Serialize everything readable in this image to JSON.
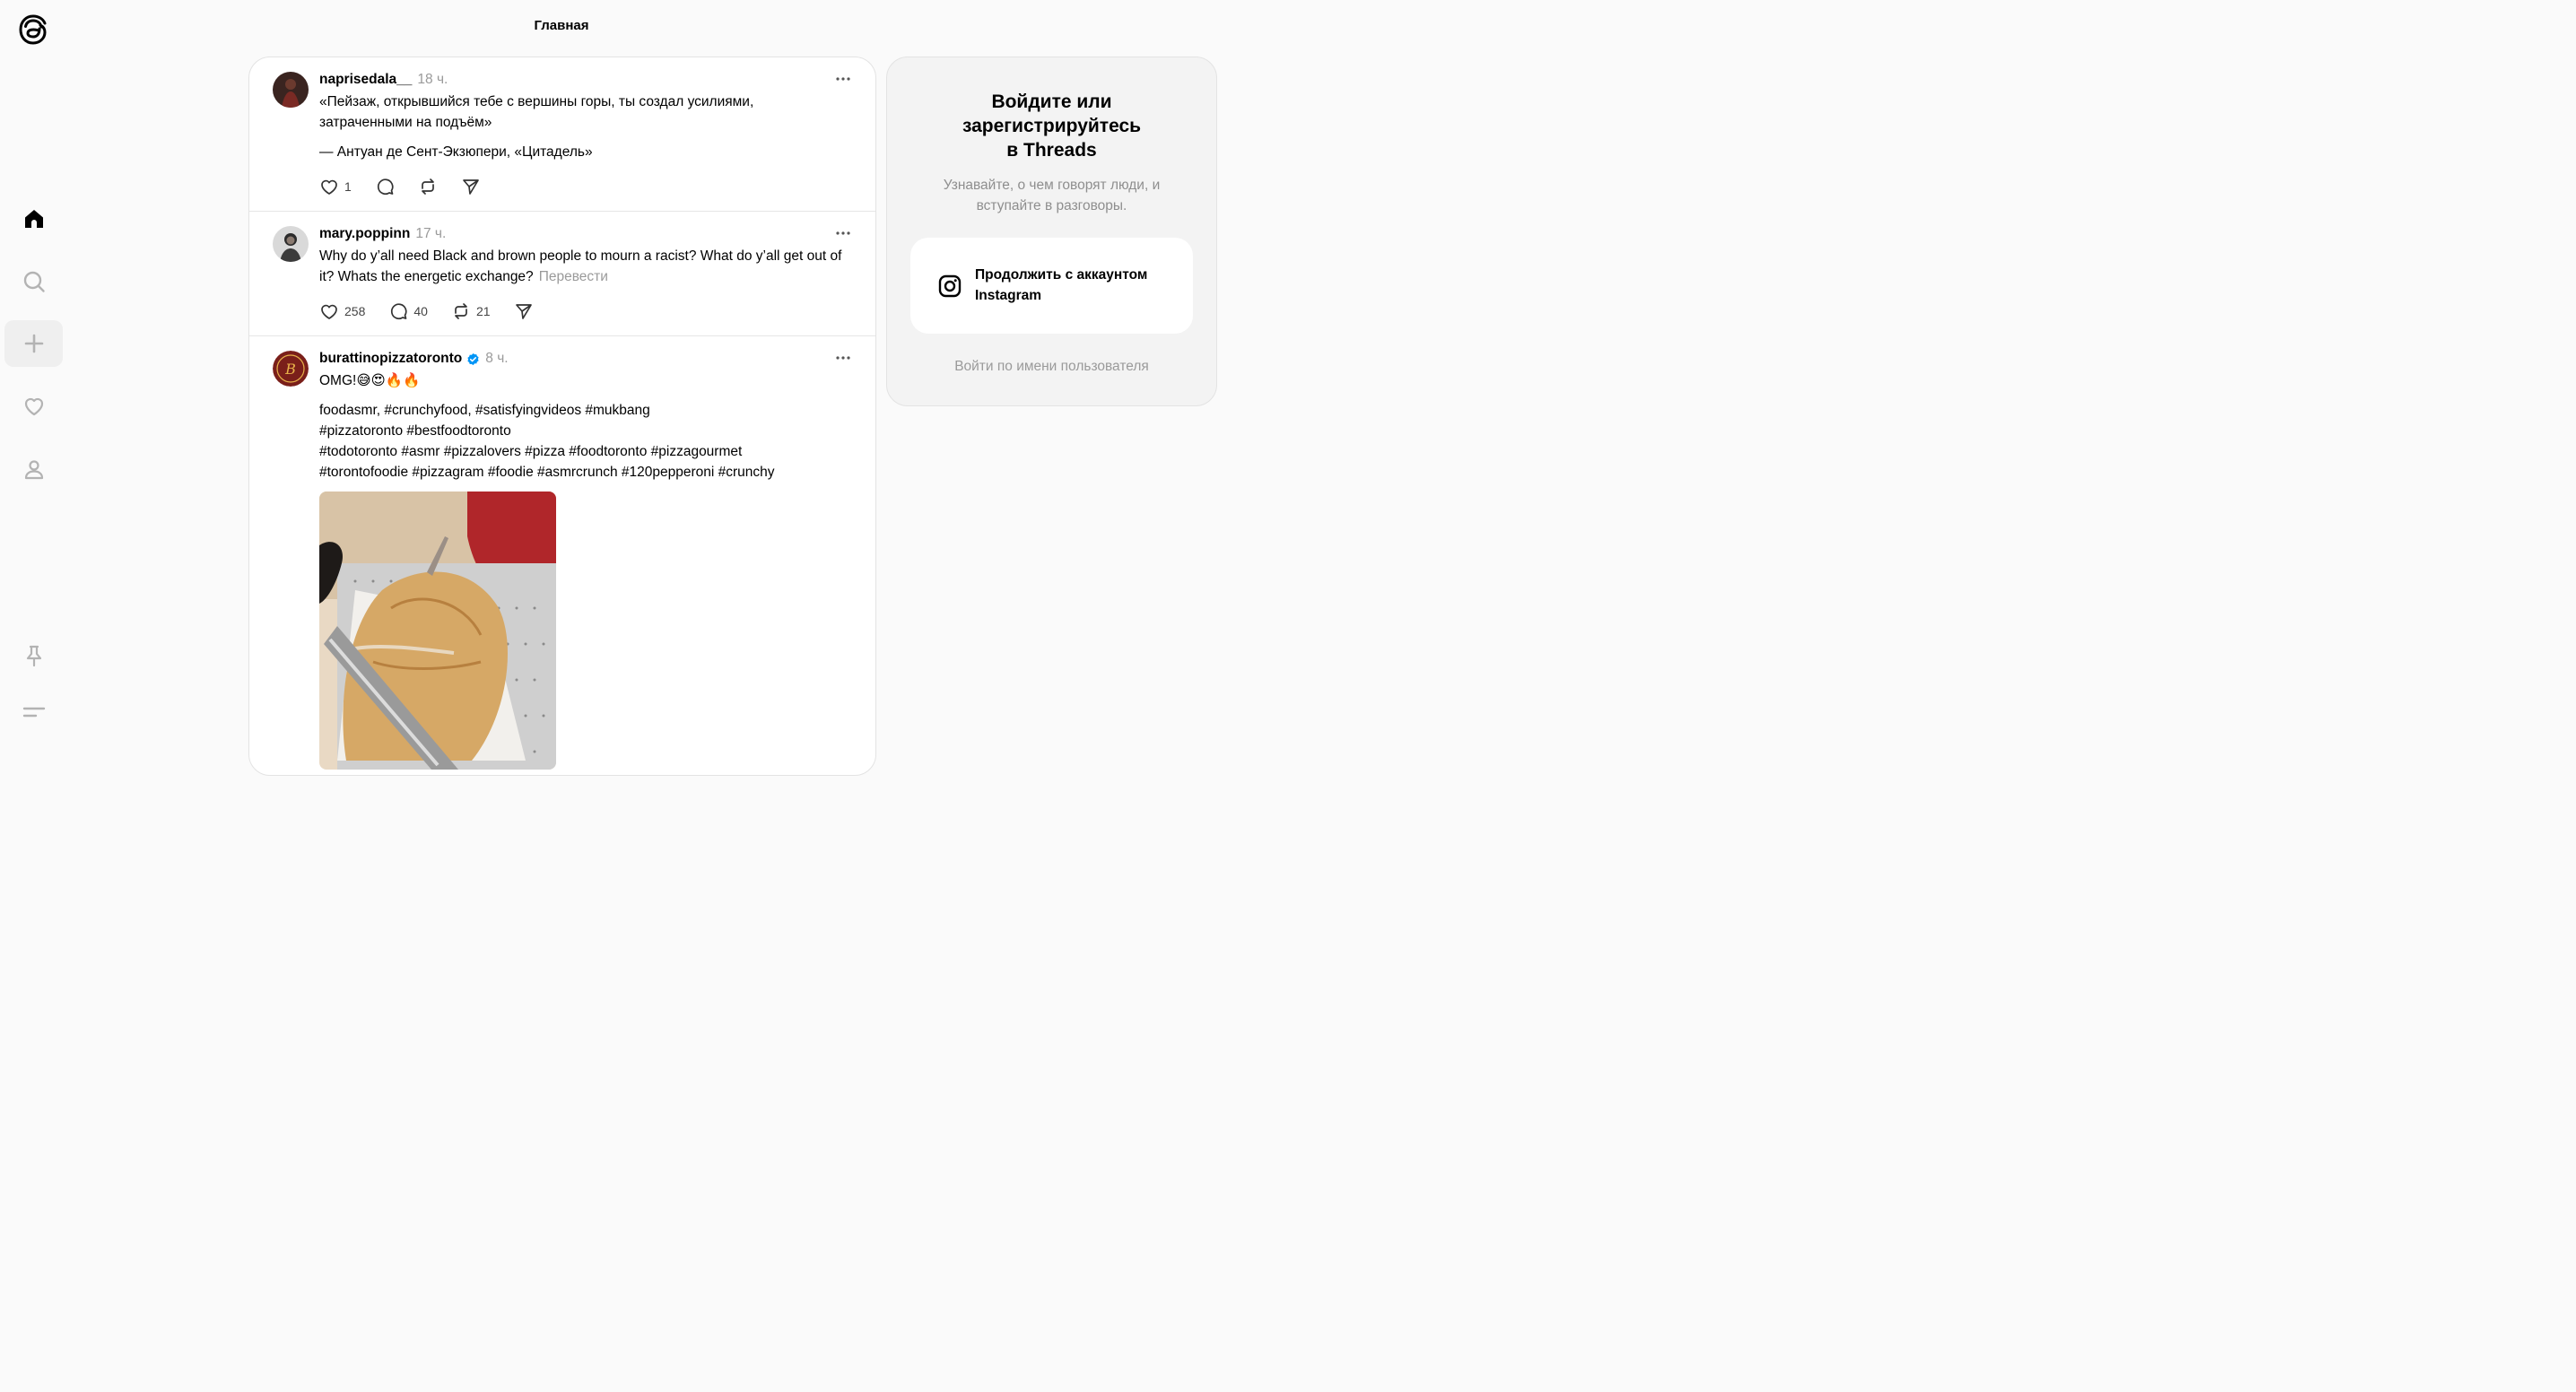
{
  "header": {
    "title": "Главная"
  },
  "sidebar": {
    "items": [
      {
        "icon": "home-icon"
      },
      {
        "icon": "search-icon"
      },
      {
        "icon": "plus-icon"
      },
      {
        "icon": "heart-icon"
      },
      {
        "icon": "profile-icon"
      },
      {
        "icon": "pin-icon"
      },
      {
        "icon": "menu-icon"
      }
    ]
  },
  "posts": [
    {
      "username": "naprisedala__",
      "time": "18 ч.",
      "text_lines": [
        "«Пейзаж, открывшийся тебе с вершины горы, ты создал усилиями, затраченными на подъём»",
        "— Антуан де Сент-Экзюпери, «Цитадель»"
      ],
      "likes": "1",
      "replies": "",
      "reposts": ""
    },
    {
      "username": "mary.poppinn",
      "time": "17 ч.",
      "text": "Why do y’all need Black and brown people to mourn a racist? What do y’all get out of it? Whats the energetic exchange?",
      "translate": "Перевести",
      "likes": "258",
      "replies": "40",
      "reposts": "21"
    },
    {
      "username": "burattinopizzatoronto",
      "time": "8 ч.",
      "verified": true,
      "text_first": "OMG!😅😍🔥🔥",
      "text_lines": [
        "foodasmr, #crunchyfood, #satisfyingvideos #mukbang",
        "#pizzatoronto #bestfoodtoronto",
        "#todotoronto #asmr #pizzalovers #pizza #foodtoronto #pizzagourmet",
        "#torontofoodie #pizzagram #foodie #asmrcrunch #120pepperoni #crunchy"
      ]
    }
  ],
  "login_panel": {
    "title_line1": "Войдите или",
    "title_line2": "зарегистрируйтесь",
    "title_line3": "в Threads",
    "subtitle": "Узнавайте, о чем говорят люди, и вступайте в разговоры.",
    "instagram_button": "Продолжить с аккаунтом Instagram",
    "username_login": "Войти по имени пользователя"
  },
  "colors": {
    "accent_verified": "#0095f6",
    "muted": "#999999"
  }
}
